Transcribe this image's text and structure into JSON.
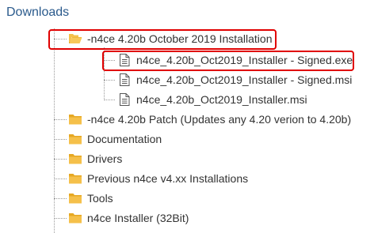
{
  "heading": "Downloads",
  "open_folder": {
    "label": "-n4ce 4.20b October 2019 Installation",
    "icon": "folder-open-icon",
    "files": [
      {
        "label": "n4ce_4.20b_Oct2019_Installer - Signed.exe",
        "icon": "file-icon"
      },
      {
        "label": "n4ce_4.20b_Oct2019_Installer - Signed.msi",
        "icon": "file-icon"
      },
      {
        "label": "n4ce_4.20b_Oct2019_Installer.msi",
        "icon": "file-icon"
      }
    ]
  },
  "folders": [
    {
      "label": "-n4ce 4.20b Patch (Updates any 4.20 verion to 4.20b)",
      "icon": "folder-icon"
    },
    {
      "label": "Documentation",
      "icon": "folder-icon"
    },
    {
      "label": "Drivers",
      "icon": "folder-icon"
    },
    {
      "label": "Previous n4ce v4.xx Installations",
      "icon": "folder-icon"
    },
    {
      "label": "Tools",
      "icon": "folder-icon"
    },
    {
      "label": "n4ce Installer (32Bit)",
      "icon": "folder-icon"
    }
  ],
  "colors": {
    "heading": "#2a5a8c",
    "folder": "#f5c04a",
    "folder_dark": "#e6a823",
    "highlight": "#e00000",
    "tree_line": "#9a9a9a"
  }
}
